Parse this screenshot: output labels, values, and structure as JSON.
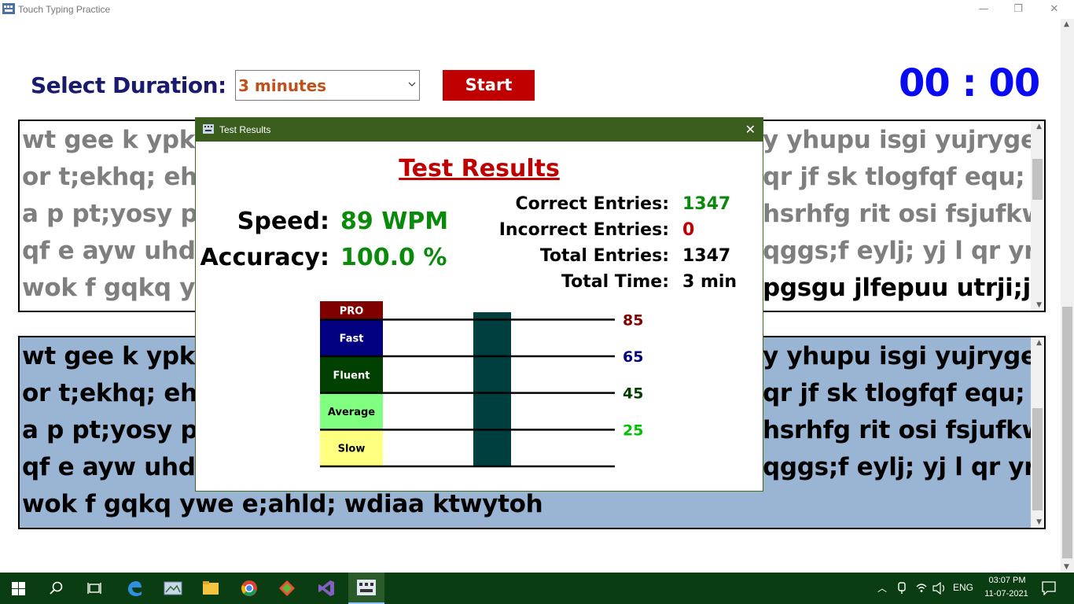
{
  "window": {
    "title": "Touch Typing Practice",
    "minimize": "—",
    "restore": "❐",
    "close": "✕"
  },
  "controls": {
    "duration_label": "Select Duration:",
    "duration_value": "3 minutes",
    "start_label": "Start",
    "timer": "00 : 00"
  },
  "source_text": {
    "lines": [
      "wt gee k ypklr",
      "or t;ekhq; ehy",
      "a p pt;yosy pa",
      "qf e ayw uhdc",
      "wok f gqkq yw"
    ],
    "lines_right": [
      "y yhupu isgi yujryge",
      "qr jf sk tlogfqf equ; q",
      "hsrhfg rit osi fsjufkw",
      "qggs;f eylj; yj l qr yrl",
      "pgsgu jlfepuu utrji;j"
    ]
  },
  "typed_text": {
    "lines": [
      "wt gee k ypklr",
      "or t;ekhq; ehy",
      "a p pt;yosy pa",
      "qf e ayw uhdc",
      "wok f gqkq ywe e;ahld; wdiaa ktwytoh"
    ],
    "lines_right": [
      "y yhupu isgi yujryge",
      "qr jf sk tlogfqf equ; q",
      "hsrhfg rit osi fsjufkw",
      "qggs;f eylj; yj l qr yrl",
      ""
    ]
  },
  "dialog": {
    "title": "Test Results",
    "heading": "Test Results",
    "close": "✕",
    "speed_label": "Speed:",
    "speed_value": "89 WPM",
    "accuracy_label": "Accuracy:",
    "accuracy_value": "100.0 %",
    "correct_label": "Correct Entries:",
    "correct_value": "1347",
    "incorrect_label": "Incorrect Entries:",
    "incorrect_value": "0",
    "total_label": "Total Entries:",
    "total_value": "1347",
    "time_label": "Total Time:",
    "time_value": "3 min"
  },
  "chart_data": {
    "type": "bar",
    "value": 89,
    "bar_color": "#003f3f",
    "levels": [
      {
        "name": "PRO",
        "color": "#800000",
        "text_color": "#ffffff"
      },
      {
        "name": "Fast",
        "color": "#000080",
        "text_color": "#ffffff"
      },
      {
        "name": "Fluent",
        "color": "#004000",
        "text_color": "#ffffff"
      },
      {
        "name": "Average",
        "color": "#80ff80",
        "text_color": "#000000"
      },
      {
        "name": "Slow",
        "color": "#ffff80",
        "text_color": "#000000"
      }
    ],
    "thresholds": [
      {
        "label": "85",
        "value": 85,
        "color": "#800000"
      },
      {
        "label": "65",
        "value": 65,
        "color": "#000080"
      },
      {
        "label": "45",
        "value": 45,
        "color": "#004000"
      },
      {
        "label": "25",
        "value": 25,
        "color": "#00c000"
      }
    ],
    "ylim": [
      5,
      95
    ]
  },
  "taskbar": {
    "language": "ENG",
    "time": "03:07 PM",
    "date": "11-07-2021"
  }
}
